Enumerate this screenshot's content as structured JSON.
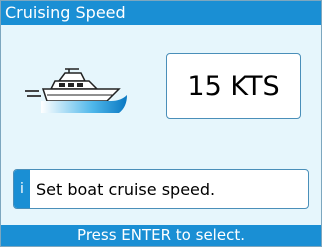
{
  "header": {
    "title": "Cruising Speed"
  },
  "boat": {
    "icon": "boat-icon"
  },
  "speed": {
    "value": "15 KTS"
  },
  "info": {
    "icon_glyph": "i",
    "text": "Set boat cruise speed."
  },
  "footer": {
    "hint": "Press ENTER to select."
  },
  "colors": {
    "accent": "#1a8fd4",
    "background": "#e6f6fc",
    "border": "#4a8fb9"
  }
}
